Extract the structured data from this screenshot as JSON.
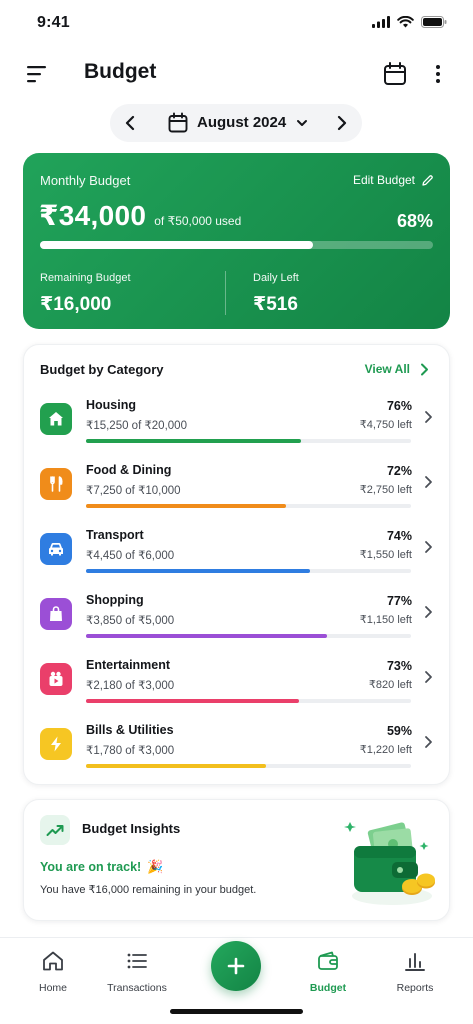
{
  "status_bar": {
    "time": "9:41"
  },
  "header": {
    "title": "Budget"
  },
  "month_selector": {
    "label": "August 2024"
  },
  "summary": {
    "label": "Monthly Budget",
    "edit_label": "Edit Budget",
    "spent": "₹34,000",
    "of_text": "of ₹50,000 used",
    "percent_text": "68%",
    "progress_fraction": 0.695,
    "remaining_label": "Remaining Budget",
    "remaining_value": "₹16,000",
    "daily_label": "Daily Left",
    "daily_value": "₹516"
  },
  "categories": {
    "title": "Budget by Category",
    "view_all": "View All",
    "items": [
      {
        "name": "Housing",
        "spent": "₹15,250 of ₹20,000",
        "percent": "76%",
        "left": "₹4,750 left",
        "progress": 0.66,
        "color": "#22a04f",
        "bg": "#22a04f",
        "icon": "house-icon"
      },
      {
        "name": "Food & Dining",
        "spent": "₹7,250 of ₹10,000",
        "percent": "72%",
        "left": "₹2,750 left",
        "progress": 0.615,
        "color": "#f08c1a",
        "bg": "#f08c1a",
        "icon": "utensils-icon"
      },
      {
        "name": "Transport",
        "spent": "₹4,450 of ₹6,000",
        "percent": "74%",
        "left": "₹1,550 left",
        "progress": 0.69,
        "color": "#2f7de1",
        "bg": "#2f7de1",
        "icon": "car-icon"
      },
      {
        "name": "Shopping",
        "spent": "₹3,850 of ₹5,000",
        "percent": "77%",
        "left": "₹1,150 left",
        "progress": 0.74,
        "color": "#9b4fd6",
        "bg": "#9b4fd6",
        "icon": "shopping-bag-icon"
      },
      {
        "name": "Entertainment",
        "spent": "₹2,180 of ₹3,000",
        "percent": "73%",
        "left": "₹820 left",
        "progress": 0.655,
        "color": "#ea3f6a",
        "bg": "#ea3f6a",
        "icon": "film-icon"
      },
      {
        "name": "Bills & Utilities",
        "spent": "₹1,780 of ₹3,000",
        "percent": "59%",
        "left": "₹1,220 left",
        "progress": 0.555,
        "color": "#f2bf1d",
        "bg": "#f6c623",
        "icon": "lightning-icon"
      }
    ]
  },
  "insights": {
    "title": "Budget Insights",
    "on_track": "You are on track!",
    "on_track_emoji": "🎉",
    "description": "You have ₹16,000 remaining in your budget."
  },
  "nav": {
    "items": [
      {
        "label": "Home",
        "icon": "home-icon"
      },
      {
        "label": "Transactions",
        "icon": "list-icon"
      },
      {
        "label": "Budget",
        "icon": "wallet-icon",
        "active": true
      },
      {
        "label": "Reports",
        "icon": "bar-chart-icon"
      }
    ]
  },
  "colors": {
    "brand_green": "#1f9a52",
    "card_green_start": "#21a35a",
    "card_green_end": "#138445"
  }
}
